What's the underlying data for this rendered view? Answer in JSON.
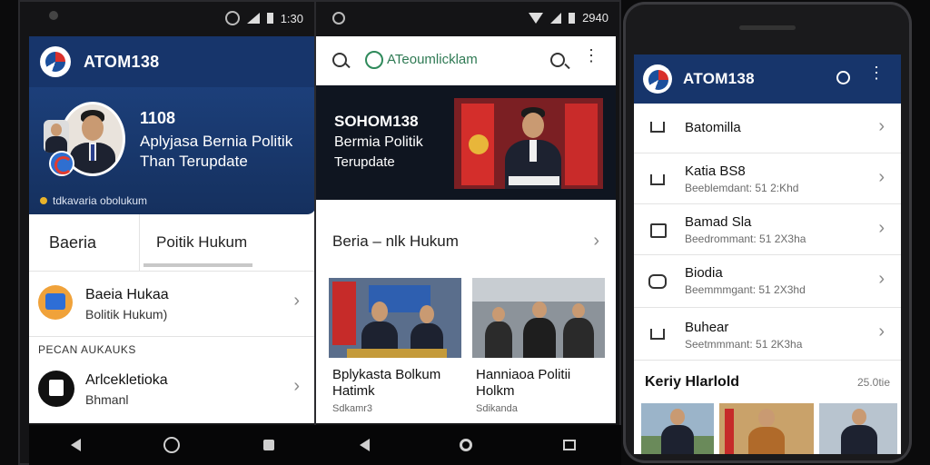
{
  "phone1": {
    "status_time": "1:30",
    "app_title": "ATOM138",
    "hero": {
      "number": "1108",
      "line1": "Aplyjasa Bernia Politik",
      "line2": "Than Terupdate",
      "footer": "tdkavaria obolukum"
    },
    "tabs": [
      "Baeria",
      "Poitik Hukum"
    ],
    "items": [
      {
        "title": "Baeia Hukaa",
        "subtitle": "Bolitik Hukum)"
      },
      {
        "title": "Arlcekletioka",
        "subtitle": "Bhmanl"
      }
    ],
    "section_label": "PECAN AUKAUKS"
  },
  "phone2": {
    "status_time": "2940",
    "app_title": "ATeoumlicklam",
    "hero": {
      "line1": "SOHOM138",
      "line2": "Bermia Politik",
      "line3": "Terupdate"
    },
    "section_title": "Beria – nlk Hukum",
    "cards": [
      {
        "line1": "Bplykasta Bolkum",
        "line2": "Hatimk",
        "meta": "Sdkamr3"
      },
      {
        "line1": "Hanniaoa Politii",
        "line2": "Holkm",
        "meta": "Sdikanda"
      }
    ]
  },
  "phone3": {
    "app_title": "ATOM138",
    "items": [
      {
        "title": "Batomilla",
        "subtitle": ""
      },
      {
        "title": "Katia BS8",
        "subtitle": "Beeblemdant: 51 2:Khd"
      },
      {
        "title": "Bamad Sla",
        "subtitle": "Beedrommant: 51 2X3ha"
      },
      {
        "title": "Biodia",
        "subtitle": "Beemmmgant: 51 2X3hd"
      },
      {
        "title": "Buhear",
        "subtitle": "Seetmmmant: 51 2K3ha"
      }
    ],
    "section_title": "Keriy Hlarlold",
    "section_meta": "25.0tie"
  },
  "colors": {
    "primary": "#17356b",
    "white": "#ffffff",
    "muted": "#6b6b6b"
  }
}
